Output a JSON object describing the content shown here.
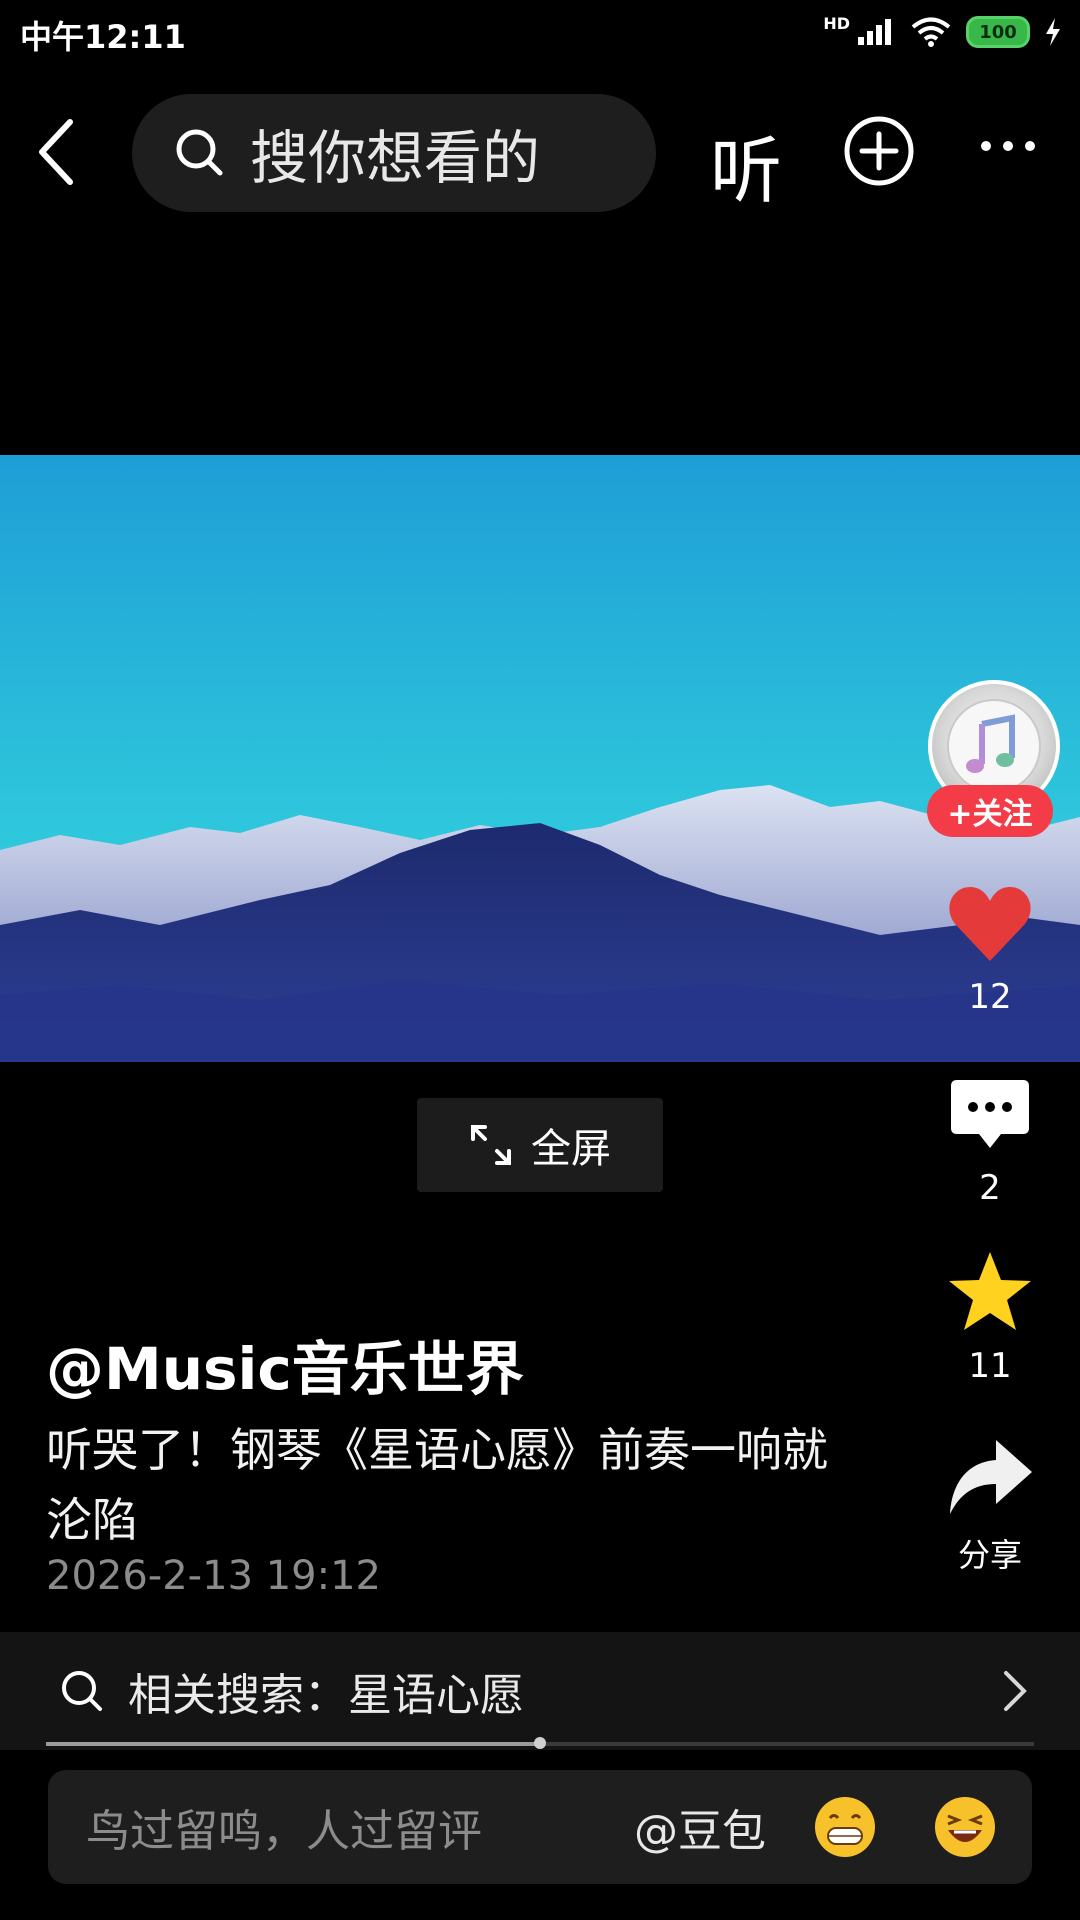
{
  "status_bar": {
    "time": "中午12:11",
    "network": "HD",
    "battery": "100"
  },
  "top_bar": {
    "search_placeholder": "搜你想看的",
    "listen_label": "听"
  },
  "video": {
    "fullscreen_label": "全屏"
  },
  "actions": {
    "follow_label": "+关注",
    "likes": "12",
    "comments": "2",
    "favorites": "11",
    "share_label": "分享"
  },
  "post": {
    "author": "@Music音乐世界",
    "description": "听哭了！钢琴《星语心愿》前奏一响就沦陷",
    "date": "2026-2-13 19:12"
  },
  "related": {
    "text": "相关搜索：星语心愿"
  },
  "playback": {
    "progress": 0.5
  },
  "comment_bar": {
    "placeholder": "鸟过留鸣，人过留评",
    "mention_label": "@豆包"
  },
  "colors": {
    "accent_red": "#f43b48",
    "heart_red": "#e53a3a",
    "star_yellow": "#ffd21f",
    "sky_cyan": "#26c0d8",
    "mountain_blue": "#1c2f78"
  }
}
